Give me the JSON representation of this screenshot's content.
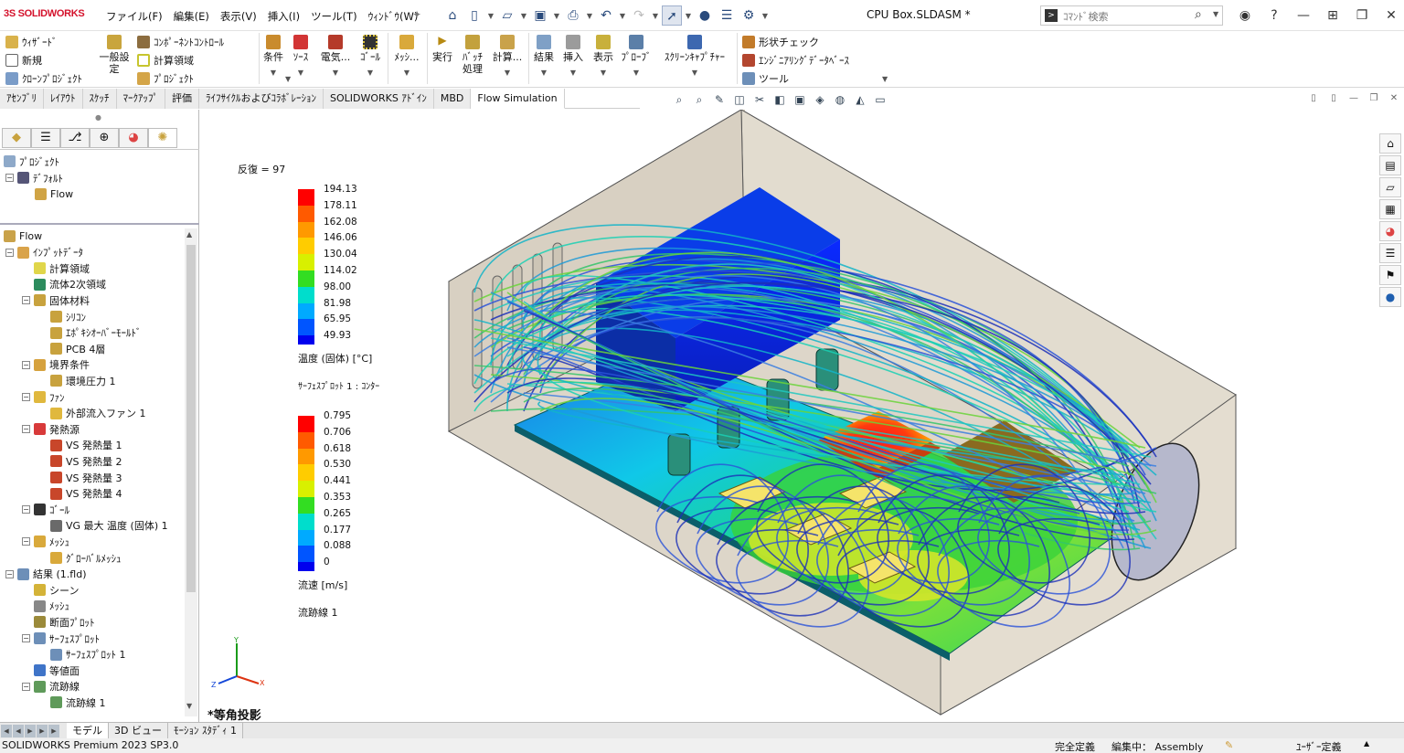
{
  "app": {
    "logo": "SOLIDWORKS",
    "doc_title": "CPU Box.SLDASM *"
  },
  "menu": [
    "ファイル(F)",
    "編集(E)",
    "表示(V)",
    "挿入(I)",
    "ツール(T)",
    "ｳｨﾝﾄﾞｳ(W)"
  ],
  "search": {
    "placeholder": "ｺﾏﾝﾄﾞ検索"
  },
  "commands": {
    "left": [
      "ｳｨｻﾞｰﾄﾞ",
      "新規",
      "ｸﾛｰﾝﾌﾟﾛｼﾞｪｸﾄ"
    ],
    "general": "一般設\n定",
    "comp_control": "ｺﾝﾎﾟｰﾈﾝﾄｺﾝﾄﾛｰﾙ",
    "calc_domain": "計算領域",
    "project": "ﾌﾟﾛｼﾞｪｸﾄ",
    "cond": "条件",
    "source": "ｿｰｽ",
    "elec": "電気...",
    "goal": "ｺﾞｰﾙ",
    "mesh": "ﾒｯｼ...",
    "run": "実行",
    "batch": "ﾊﾞｯﾁ\n処理",
    "calc": "計算...",
    "results": "結果",
    "insert": "挿入",
    "display": "表示",
    "probe": "ﾌﾟﾛｰﾌﾞ",
    "capture": "ｽｸﾘｰﾝｷｬﾌﾟﾁｬｰ",
    "check": "形状チェック",
    "eng_db": "ｴﾝｼﾞﾆｱﾘﾝｸﾞﾃﾞｰﾀﾍﾞｰｽ",
    "tools": "ツール"
  },
  "tabs": [
    "ｱｾﾝﾌﾞﾘ",
    "ﾚｲｱｳﾄ",
    "ｽｹｯﾁ",
    "ﾏｰｸｱｯﾌﾟ",
    "評価",
    "ﾗｲﾌｻｲｸﾙおよびｺﾗﾎﾞﾚｰｼｮﾝ",
    "SOLIDWORKS ｱﾄﾞｲﾝ",
    "MBD",
    "Flow Simulation"
  ],
  "project_tree": [
    "ﾌﾟﾛｼﾞｪｸﾄ",
    "ﾃﾞﾌｫﾙﾄ",
    "Flow"
  ],
  "tree": [
    {
      "t": "Flow",
      "d": 0
    },
    {
      "t": "ｲﾝﾌﾟｯﾄﾃﾞｰﾀ",
      "d": 1
    },
    {
      "t": "計算領域",
      "d": 2
    },
    {
      "t": "流体2次領域",
      "d": 2
    },
    {
      "t": "固体材料",
      "d": 2
    },
    {
      "t": "ｼﾘｺﾝ",
      "d": 3
    },
    {
      "t": "ｴﾎﾟｷｼｵｰﾊﾞｰﾓｰﾙﾄﾞ",
      "d": 3
    },
    {
      "t": "PCB 4層",
      "d": 3
    },
    {
      "t": "境界条件",
      "d": 2
    },
    {
      "t": "環境圧力 1",
      "d": 3
    },
    {
      "t": "ﾌｧﾝ",
      "d": 2
    },
    {
      "t": "外部流入ファン 1",
      "d": 3
    },
    {
      "t": "発熱源",
      "d": 2
    },
    {
      "t": "VS 発熱量 1",
      "d": 3
    },
    {
      "t": "VS 発熱量 2",
      "d": 3
    },
    {
      "t": "VS 発熱量 3",
      "d": 3
    },
    {
      "t": "VS 発熱量 4",
      "d": 3
    },
    {
      "t": "ｺﾞｰﾙ",
      "d": 2
    },
    {
      "t": "VG 最大 温度 (固体) 1",
      "d": 3
    },
    {
      "t": "ﾒｯｼｭ",
      "d": 2
    },
    {
      "t": "ｸﾞﾛｰﾊﾞﾙﾒｯｼｭ",
      "d": 3
    },
    {
      "t": "結果 (1.fld)",
      "d": 1
    },
    {
      "t": "シーン",
      "d": 2
    },
    {
      "t": "ﾒｯｼｭ",
      "d": 2
    },
    {
      "t": "断面ﾌﾟﾛｯﾄ",
      "d": 2
    },
    {
      "t": "ｻｰﾌｪｽﾌﾟﾛｯﾄ",
      "d": 2
    },
    {
      "t": "ｻｰﾌｪｽﾌﾟﾛｯﾄ 1",
      "d": 3
    },
    {
      "t": "等値面",
      "d": 2
    },
    {
      "t": "流跡線",
      "d": 2
    },
    {
      "t": "流跡線 1",
      "d": 3
    }
  ],
  "iteration": "反復 = 97",
  "legend_temp": {
    "values": [
      "194.13",
      "178.11",
      "162.08",
      "146.06",
      "130.04",
      "114.02",
      "98.00",
      "81.98",
      "65.95",
      "49.93"
    ],
    "label": "温度 (固体) [°C]",
    "sub": "ｻｰﾌｪｽﾌﾟﾛｯﾄ 1 : ｺﾝﾀｰ"
  },
  "legend_vel": {
    "values": [
      "0.795",
      "0.706",
      "0.618",
      "0.530",
      "0.441",
      "0.353",
      "0.265",
      "0.177",
      "0.088",
      "0"
    ],
    "label": "流速 [m/s]",
    "sub": "流跡線 1"
  },
  "view_label": "*等角投影",
  "bottom_tabs": [
    "モデル",
    "3D ビュー",
    "ﾓｰｼｮﾝ ｽﾀﾃﾞｨ 1"
  ],
  "status": {
    "product": "SOLIDWORKS Premium 2023 SP3.0",
    "defined": "完全定義",
    "editing": "編集中： Assembly",
    "units": "ﾕｰｻﾞｰ定義"
  }
}
